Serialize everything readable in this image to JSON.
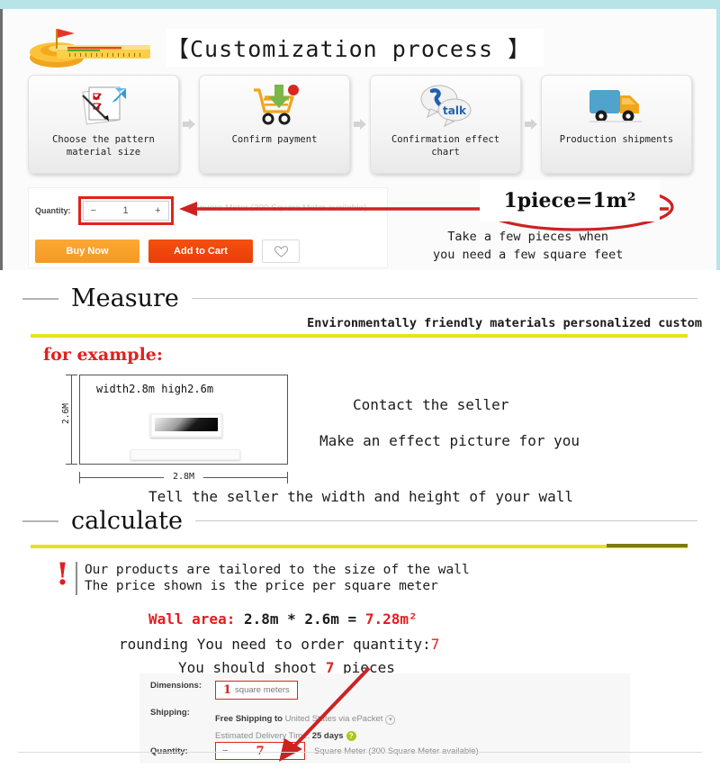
{
  "top_panel": {
    "title": "【Customization process 】",
    "logo_icon": "tape-measure-icon",
    "steps": [
      {
        "label": "Choose the pattern\nmaterial size",
        "icon": "document-pen-icon"
      },
      {
        "label": "Confirm payment",
        "icon": "shopping-cart-download-icon"
      },
      {
        "label": "Confirmation effect\nchart",
        "icon": "chat-talk-icon"
      },
      {
        "label": "Production shipments",
        "icon": "delivery-truck-icon"
      }
    ],
    "quantity": {
      "label": "Quantity:",
      "minus": "−",
      "value": "1",
      "plus": "+",
      "availability": "Square Meter (300 Square Meter available)"
    },
    "buttons": {
      "buy_now": "Buy Now",
      "add_to_cart": "Add to Cart",
      "wishlist_icon": "heart-icon"
    },
    "callout": {
      "piece_equals": "1piece=1m²",
      "note_line1": "Take a few pieces when",
      "note_line2": "you need a few square feet"
    }
  },
  "measure_section": {
    "heading": "Measure",
    "tagline": "Environmentally friendly materials personalized custom",
    "for_example": "for example:",
    "wall_diagram": {
      "dims_text": "width2.8m  high2.6m",
      "height_label": "2.6M",
      "width_label": "2.8M"
    },
    "contact_line1": "Contact the seller",
    "contact_line2": "Make an effect picture for you",
    "contact_line3": "Tell the seller the width and height of your wall"
  },
  "calculate_section": {
    "heading": "calculate",
    "warn_icon": "exclamation-icon",
    "warn_line1": "Our products are tailored to the size of the wall",
    "warn_line2": "The price shown is the price per square meter",
    "wall_area_label": "Wall area:",
    "wall_area_expr": " 2.8m * 2.6m = ",
    "wall_area_result": "7.28m²",
    "rounding_text": "rounding  You need to order quantity:",
    "rounding_value": "7",
    "shoot_prefix": "You should shoot ",
    "shoot_value": "7",
    "shoot_suffix": " pieces"
  },
  "order_form": {
    "dimensions_label": "Dimensions:",
    "dimensions_value": "1",
    "dimensions_unit": "square meters",
    "shipping_label": "Shipping:",
    "shipping_value_bold": "Free Shipping to",
    "shipping_value_rest": " United States via ePacket",
    "delivery_label": "Estimated Delivery Time: ",
    "delivery_value": "25 days",
    "quantity_label": "Quantity:",
    "quantity_minus": "−",
    "quantity_value": "7",
    "quantity_plus": "+",
    "quantity_availability": "Square Meter (300 Square Meter available)"
  },
  "colors": {
    "accent_teal": "#b8e4e8",
    "accent_red": "#e31e1e",
    "accent_yellow": "#e6e21e",
    "buy_orange": "#f59a22",
    "cart_orange": "#e83e08"
  }
}
